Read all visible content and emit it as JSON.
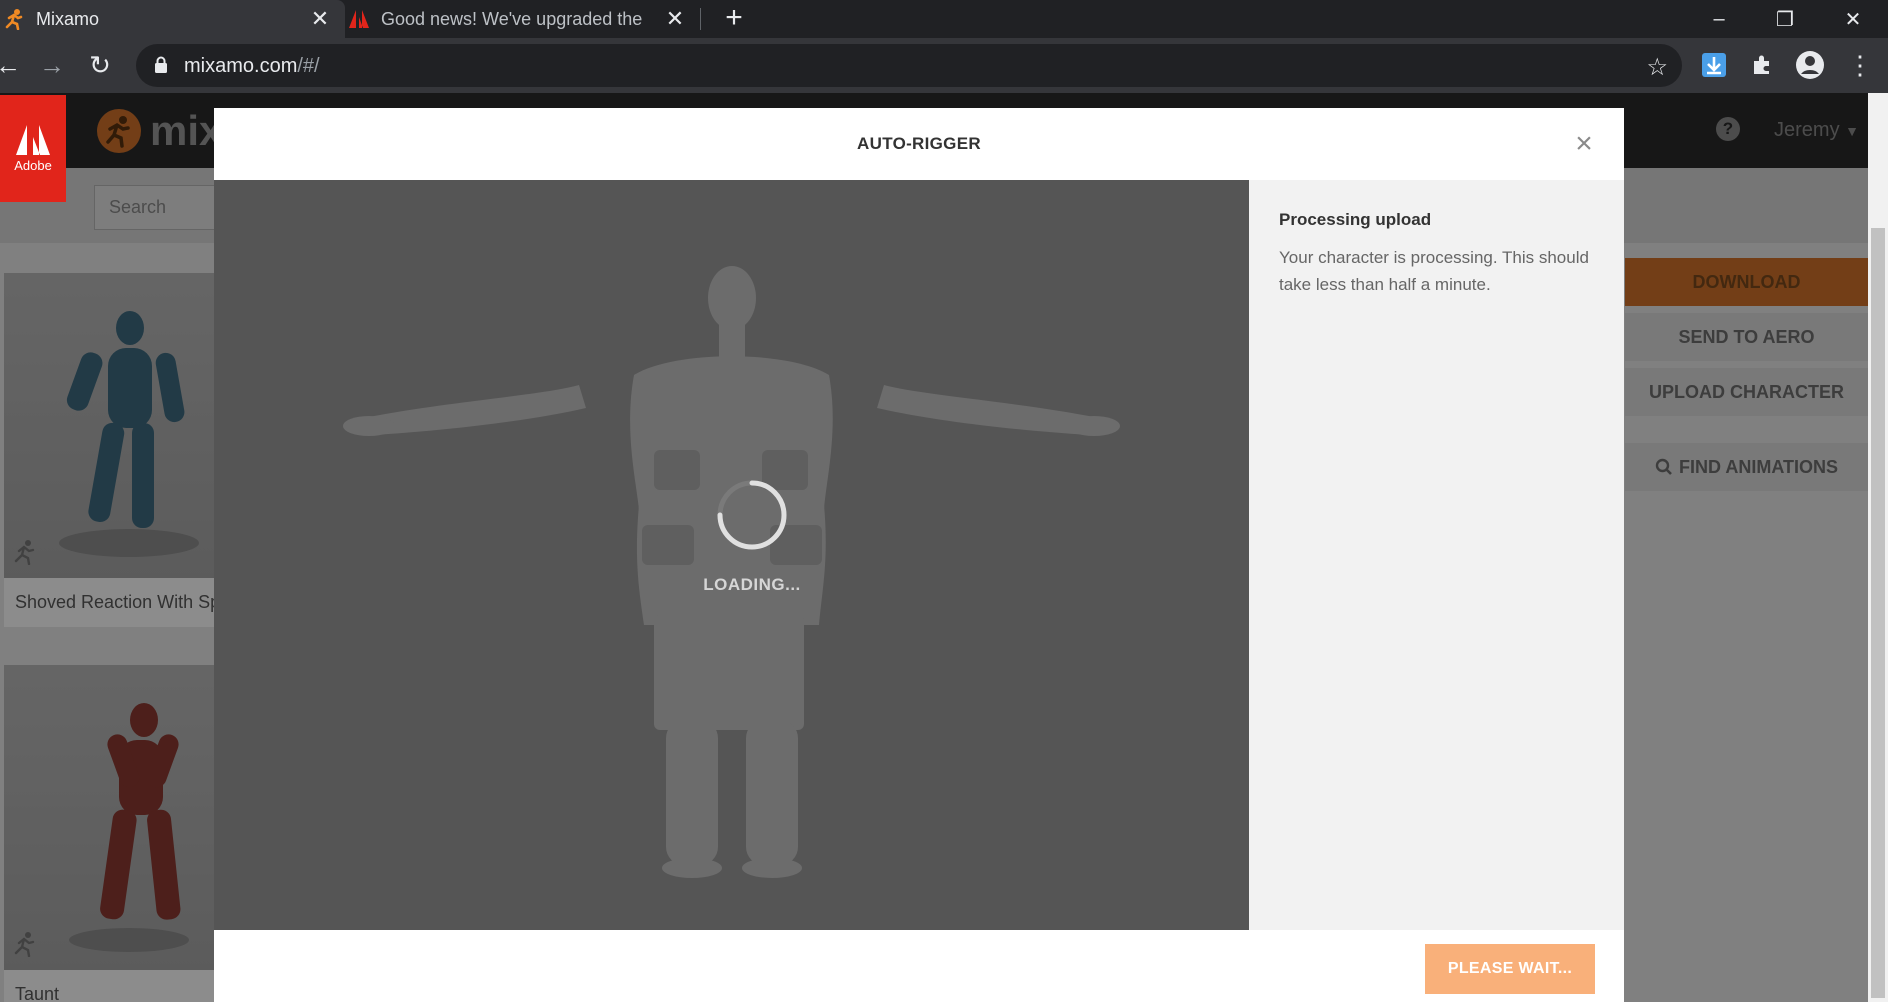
{
  "browser": {
    "tabs": [
      {
        "title": "Mixamo",
        "favicon": "mixamo-runner-icon"
      },
      {
        "title": "Good news! We've upgraded the",
        "favicon": "adobe-logo-icon"
      }
    ],
    "url_host": "mixamo.com",
    "url_path": "/#/"
  },
  "mixamo": {
    "logo_text": "mix",
    "adobe_label": "Adobe",
    "user_name": "Jeremy",
    "search_placeholder": "Search",
    "cards": [
      {
        "name": "Shoved Reaction With Sp"
      },
      {
        "name": "Taunt"
      }
    ],
    "side_buttons": {
      "download": "DOWNLOAD",
      "send_to_aero": "SEND TO AERO",
      "upload_character": "UPLOAD CHARACTER",
      "find_animations": "FIND ANIMATIONS"
    },
    "colors": {
      "accent": "#d1722a",
      "adobe_red": "#e1251b"
    }
  },
  "modal": {
    "title": "AUTO-RIGGER",
    "loading_text": "LOADING...",
    "info_title": "Processing upload",
    "info_body": "Your character is processing. This should take less than half a minute.",
    "wait_button": "PLEASE WAIT...",
    "colors": {
      "wait_button": "#f9b07a",
      "viewport_bg": "#555555"
    }
  }
}
